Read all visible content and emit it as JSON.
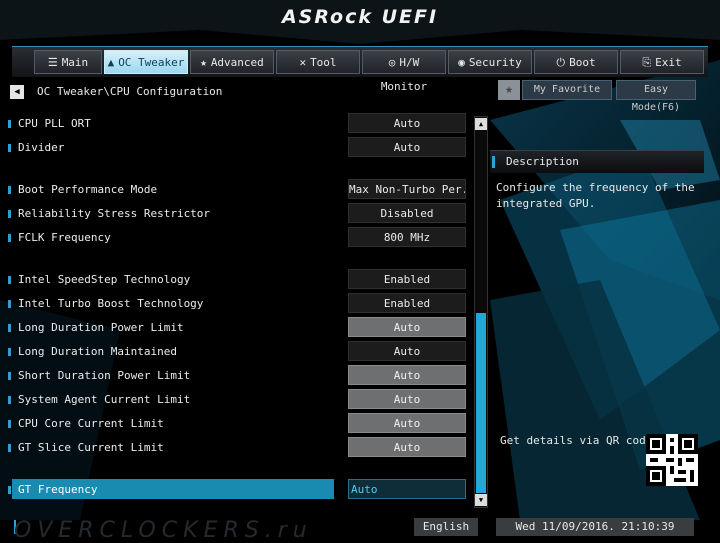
{
  "header": {
    "brand": "ASRock UEFI"
  },
  "nav": {
    "tabs": [
      {
        "label": "Main",
        "icon": "list-icon",
        "glyph": "☰",
        "active": false
      },
      {
        "label": "OC Tweaker",
        "icon": "flame-icon",
        "glyph": "🔥",
        "active": true
      },
      {
        "label": "Advanced",
        "icon": "star-icon",
        "glyph": "★",
        "active": false
      },
      {
        "label": "Tool",
        "icon": "tools-icon",
        "glyph": "✕",
        "active": false
      },
      {
        "label": "H/W Monitor",
        "icon": "monitor-icon",
        "glyph": "◎",
        "active": false
      },
      {
        "label": "Security",
        "icon": "shield-icon",
        "glyph": "◉",
        "active": false
      },
      {
        "label": "Boot",
        "icon": "power-icon",
        "glyph": "⏻",
        "active": false
      },
      {
        "label": "Exit",
        "icon": "exit-icon",
        "glyph": "⎘",
        "active": false
      }
    ]
  },
  "breadcrumb": "OC Tweaker\\CPU Configuration",
  "toolbar": {
    "favorite_label": "My Favorite",
    "easy_mode_label": "Easy Mode(F6)"
  },
  "settings": [
    {
      "label": "CPU PLL ORT",
      "value": "Auto"
    },
    {
      "label": "Divider",
      "value": "Auto"
    },
    {
      "label": "Boot Performance Mode",
      "value": "Max Non-Turbo Per..."
    },
    {
      "label": "Reliability Stress Restrictor",
      "value": "Disabled"
    },
    {
      "label": "FCLK Frequency",
      "value": "800 MHz"
    },
    {
      "label": "Intel SpeedStep Technology",
      "value": "Enabled"
    },
    {
      "label": "Intel Turbo Boost Technology",
      "value": "Enabled"
    },
    {
      "label": "Long Duration Power Limit",
      "value": "Auto"
    },
    {
      "label": "Long Duration Maintained",
      "value": "Auto"
    },
    {
      "label": "Short Duration Power Limit",
      "value": "Auto"
    },
    {
      "label": "System Agent Current Limit",
      "value": "Auto"
    },
    {
      "label": "CPU Core Current Limit",
      "value": "Auto"
    },
    {
      "label": "GT Slice Current Limit",
      "value": "Auto"
    },
    {
      "label": "GT Frequency",
      "value": "Auto"
    }
  ],
  "description": {
    "title": "Description",
    "text": "Configure the frequency of the integrated GPU."
  },
  "qr": {
    "label": "Get details via QR code"
  },
  "footer": {
    "watermark": "OVERCLOCKERS.ru",
    "language": "English",
    "datetime": "Wed 11/09/2016. 21:10:39"
  },
  "colors": {
    "accent": "#1a8bb0",
    "tab_active": "#9bd7ef",
    "scroll_thumb": "#22a8d6"
  }
}
